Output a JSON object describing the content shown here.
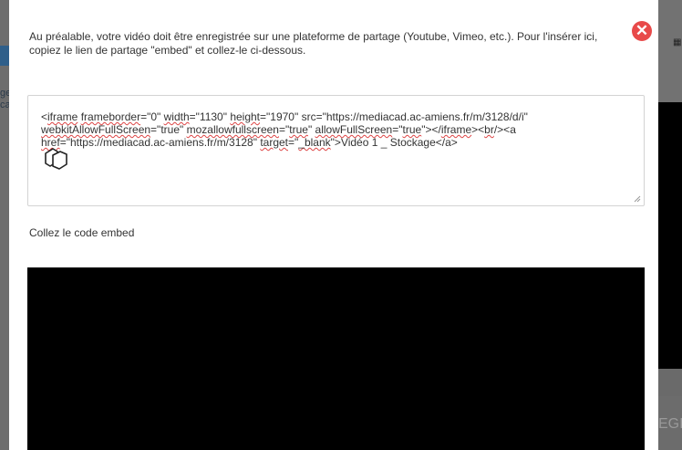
{
  "background": {
    "left_fragment": "ge\ncap",
    "right_button_fragment": "EGI",
    "right_icon": "grid-icon"
  },
  "modal": {
    "intro_text": "Au préalable, votre vidéo doit être enregistrée sur une plateforme de partage (Youtube, Vimeo, etc.). Pour l'insérer ici, copiez le lien de partage \"embed\" et collez-le ci-dessous.",
    "close_icon": "close-circle-icon",
    "close_color": "#e84a4a",
    "embed_segments": [
      {
        "t": "<",
        "sq": false
      },
      {
        "t": "iframe",
        "sq": true
      },
      {
        "t": " ",
        "sq": false
      },
      {
        "t": "frameborder",
        "sq": true
      },
      {
        "t": "=\"0\" ",
        "sq": false
      },
      {
        "t": "width",
        "sq": true
      },
      {
        "t": "=\"1130\" ",
        "sq": false
      },
      {
        "t": "height",
        "sq": true
      },
      {
        "t": "=\"1970\" src=\"https://mediacad.ac-amiens.fr/m/3128/d/i\" ",
        "sq": false
      },
      {
        "t": "webkitAllowFullScreen",
        "sq": true
      },
      {
        "t": "=\"true\" ",
        "sq": false
      },
      {
        "t": "mozallowfullscreen",
        "sq": true
      },
      {
        "t": "=\"",
        "sq": false
      },
      {
        "t": "true",
        "sq": true
      },
      {
        "t": "\" ",
        "sq": false
      },
      {
        "t": "allowFullScreen",
        "sq": true
      },
      {
        "t": "=\"",
        "sq": false
      },
      {
        "t": "true",
        "sq": true
      },
      {
        "t": "\"></",
        "sq": false
      },
      {
        "t": "iframe",
        "sq": true
      },
      {
        "t": "><",
        "sq": false
      },
      {
        "t": "br",
        "sq": true
      },
      {
        "t": "/><a ",
        "sq": false
      },
      {
        "t": "href",
        "sq": true
      },
      {
        "t": "=\"https://mediacad.ac-amiens.fr/m/3128\" ",
        "sq": false
      },
      {
        "t": "target",
        "sq": true
      },
      {
        "t": "=\"",
        "sq": false
      },
      {
        "t": "_blank",
        "sq": true
      },
      {
        "t": "\">Vidéo 1 _ Stockage</a>",
        "sq": false
      }
    ],
    "copy_icon": "copy-icon",
    "paste_label": "Collez le code embed",
    "preview_color": "#000000"
  }
}
